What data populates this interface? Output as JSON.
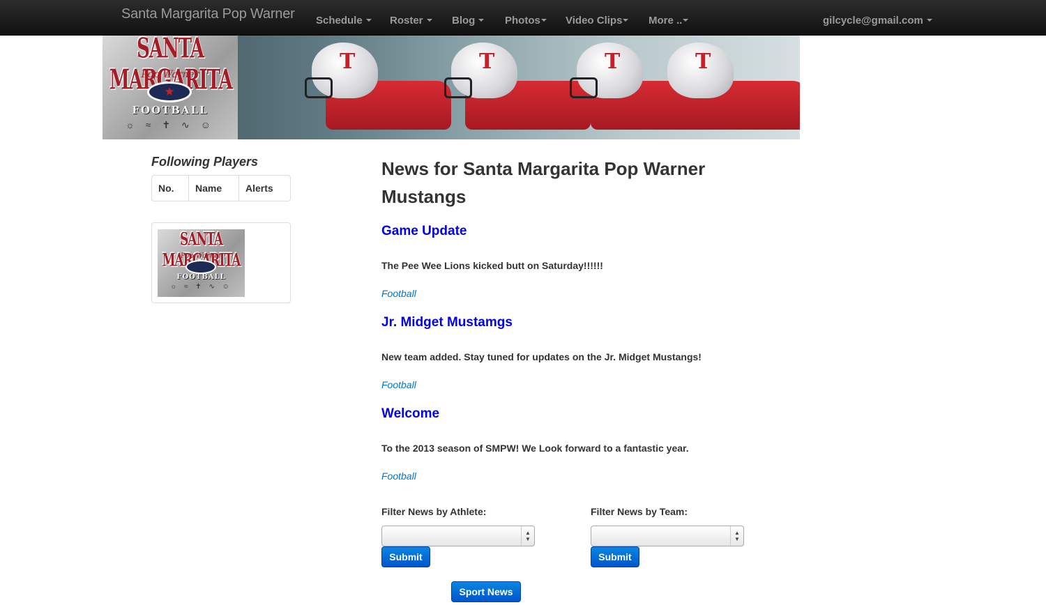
{
  "navbar": {
    "brand": "Santa Margarita Pop Warner",
    "items": [
      {
        "label": "Schedule"
      },
      {
        "label": "Roster"
      },
      {
        "label": "Blog"
      },
      {
        "label": "Photos"
      },
      {
        "label": "Video Clips"
      },
      {
        "label": "More .."
      }
    ],
    "user": "gilcycle@gmail.com"
  },
  "banner": {
    "logo": {
      "line1": "SANTA MARGARITA",
      "line2": "Pop Warner",
      "line3": "FOOTBALL"
    },
    "helmet_letter": "T"
  },
  "sidebar": {
    "title": "Following Players",
    "table_headers": [
      "No.",
      "Name",
      "Alerts"
    ]
  },
  "main": {
    "title": "News for Santa Margarita Pop Warner Mustangs",
    "news": [
      {
        "title": "Game Update",
        "body": "The Pee Wee Lions kicked butt on Saturday!!!!!!",
        "tag": "Football"
      },
      {
        "title": "Jr. Midget Mustamgs",
        "body": "New team added. Stay tuned for updates on the Jr. Midget Mustangs!",
        "tag": "Football"
      },
      {
        "title": "Welcome",
        "body": "To the 2013 season of SMPW! We Look forward to a fantastic year.",
        "tag": "Football"
      }
    ],
    "filters": {
      "athlete_label": "Filter News by Athlete:",
      "athlete_value": "",
      "team_label": "Filter News by Team:",
      "team_value": "",
      "submit_label": "Submit"
    },
    "sport_news_label": "Sport News"
  },
  "colors": {
    "link": "#0000ee",
    "tag": "#0074cc",
    "button": "#0066dd",
    "navbar": "#1b1b1b"
  }
}
